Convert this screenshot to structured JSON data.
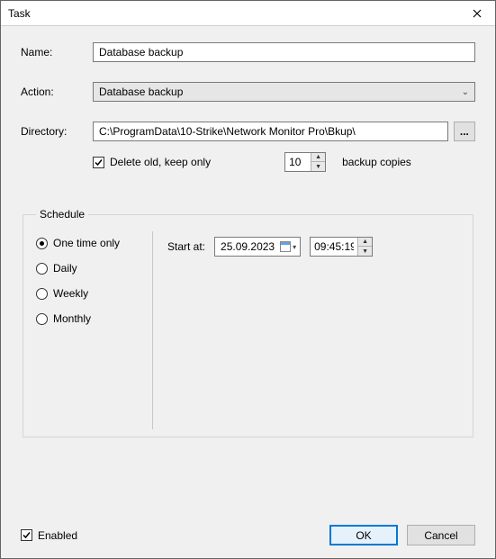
{
  "window": {
    "title": "Task"
  },
  "labels": {
    "name": "Name:",
    "action": "Action:",
    "directory": "Directory:",
    "schedule": "Schedule",
    "start_at": "Start at:",
    "backup_copies": "backup copies",
    "delete_old": "Delete old, keep only",
    "enabled": "Enabled"
  },
  "fields": {
    "name_value": "Database backup",
    "action_value": "Database backup",
    "directory_value": "C:\\ProgramData\\10-Strike\\Network Monitor Pro\\Bkup\\",
    "keep_count": "10",
    "start_date": "25.09.2023",
    "start_time": "09:45:19"
  },
  "schedule_options": {
    "one_time": "One time only",
    "daily": "Daily",
    "weekly": "Weekly",
    "monthly": "Monthly"
  },
  "state": {
    "delete_old_checked": true,
    "enabled_checked": true,
    "selected_frequency": "one_time"
  },
  "buttons": {
    "ok": "OK",
    "cancel": "Cancel",
    "browse": "..."
  }
}
